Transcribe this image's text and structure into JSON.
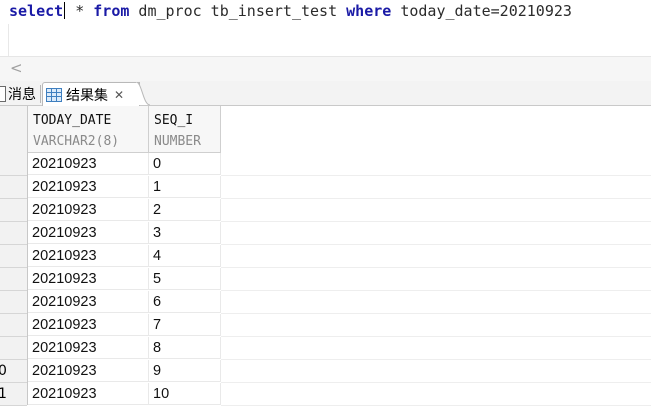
{
  "editor": {
    "sql": {
      "kw_select": "select",
      "star": " *",
      "kw_from": "from",
      "table": " dm_proc tb_insert_test ",
      "kw_where": "where",
      "condition": " today_date=20210923"
    }
  },
  "scroll": {
    "left_arrow": "<"
  },
  "tabs": {
    "messages": {
      "label": "消息"
    },
    "results": {
      "label": "结果集",
      "close": "✕",
      "icon": "grid-icon"
    }
  },
  "grid": {
    "columns": [
      {
        "name": "TODAY_DATE",
        "type": "VARCHAR2(8)"
      },
      {
        "name": "SEQ_I",
        "type": "NUMBER"
      }
    ],
    "rows": [
      {
        "num": "",
        "today_date": "20210923",
        "seq_i": "0"
      },
      {
        "num": "",
        "today_date": "20210923",
        "seq_i": "1"
      },
      {
        "num": "",
        "today_date": "20210923",
        "seq_i": "2"
      },
      {
        "num": "",
        "today_date": "20210923",
        "seq_i": "3"
      },
      {
        "num": "",
        "today_date": "20210923",
        "seq_i": "4"
      },
      {
        "num": "",
        "today_date": "20210923",
        "seq_i": "5"
      },
      {
        "num": "",
        "today_date": "20210923",
        "seq_i": "6"
      },
      {
        "num": "",
        "today_date": "20210923",
        "seq_i": "7"
      },
      {
        "num": "",
        "today_date": "20210923",
        "seq_i": "8"
      },
      {
        "num": "0",
        "today_date": "20210923",
        "seq_i": "9"
      },
      {
        "num": "1",
        "today_date": "20210923",
        "seq_i": "10"
      }
    ]
  }
}
